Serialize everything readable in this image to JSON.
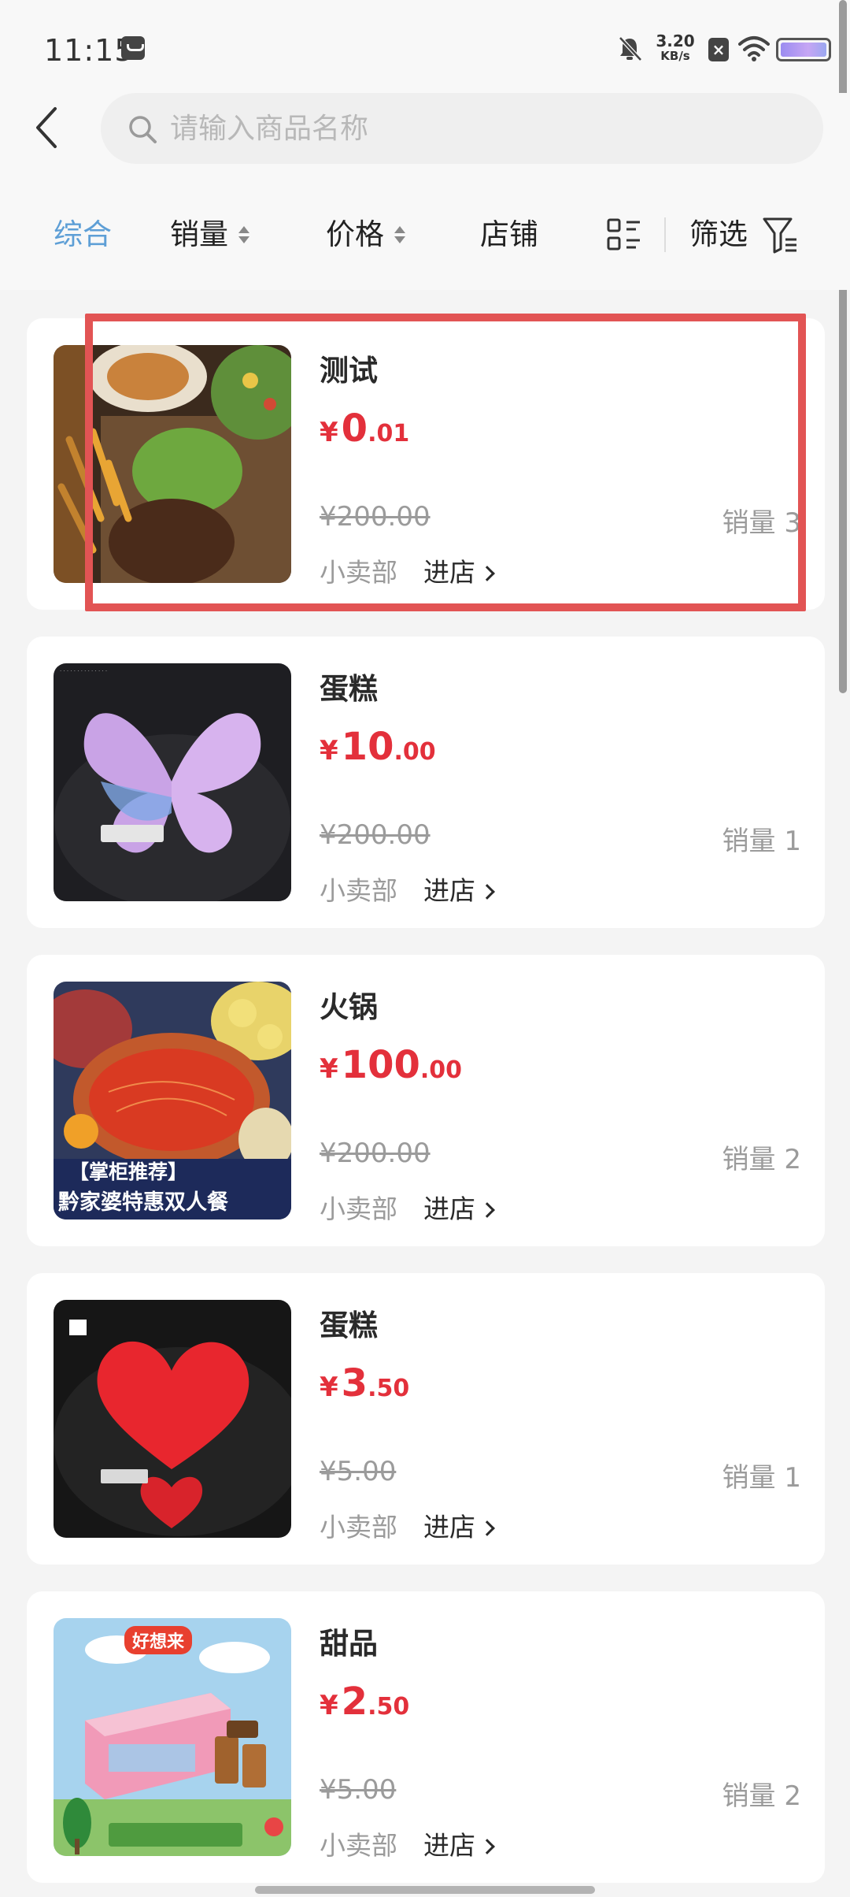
{
  "status_bar": {
    "time": "11:15",
    "net_speed_value": "3.20",
    "net_speed_unit": "KB/s",
    "sim_badge": "×",
    "icons": [
      "message-icon",
      "bell-off-icon",
      "sim-x-icon",
      "wifi-icon",
      "battery-icon"
    ]
  },
  "search": {
    "placeholder": "请输入商品名称",
    "value": ""
  },
  "sort_bar": {
    "comprehensive": "综合",
    "sales": "销量",
    "price": "价格",
    "shop": "店铺",
    "filter": "筛选",
    "active": "综合",
    "active_color": "#5e9fd6"
  },
  "products": [
    {
      "name": "测试",
      "price_symbol": "¥",
      "price_int": "0",
      "price_dec": ".01",
      "original_price": "¥200.00",
      "sales": "销量 3",
      "shop": "小卖部",
      "shop_link": "进店",
      "image": "steak-salad-pasta-image"
    },
    {
      "name": "蛋糕",
      "price_symbol": "¥",
      "price_int": "10",
      "price_dec": ".00",
      "original_price": "¥200.00",
      "sales": "销量 1",
      "shop": "小卖部",
      "shop_link": "进店",
      "image": "butterfly-cake-image"
    },
    {
      "name": "火锅",
      "price_symbol": "¥",
      "price_int": "100",
      "price_dec": ".00",
      "original_price": "¥200.00",
      "sales": "销量 2",
      "shop": "小卖部",
      "shop_link": "进店",
      "image": "hotpot-image",
      "image_text_1": "【掌柜推荐】",
      "image_text_2": "黔家婆特惠双人餐"
    },
    {
      "name": "蛋糕",
      "price_symbol": "¥",
      "price_int": "3",
      "price_dec": ".50",
      "original_price": "¥5.00",
      "sales": "销量 1",
      "shop": "小卖部",
      "shop_link": "进店",
      "image": "heart-cake-image"
    },
    {
      "name": "甜品",
      "price_symbol": "¥",
      "price_int": "2",
      "price_dec": ".50",
      "original_price": "¥5.00",
      "sales": "销量 2",
      "shop": "小卖部",
      "shop_link": "进店",
      "image": "dessert-box-image",
      "image_text_1": "好想来"
    }
  ],
  "colors": {
    "price_red": "#e3303b",
    "highlight_red": "#e25454",
    "page_bg": "#f4f4f4"
  }
}
